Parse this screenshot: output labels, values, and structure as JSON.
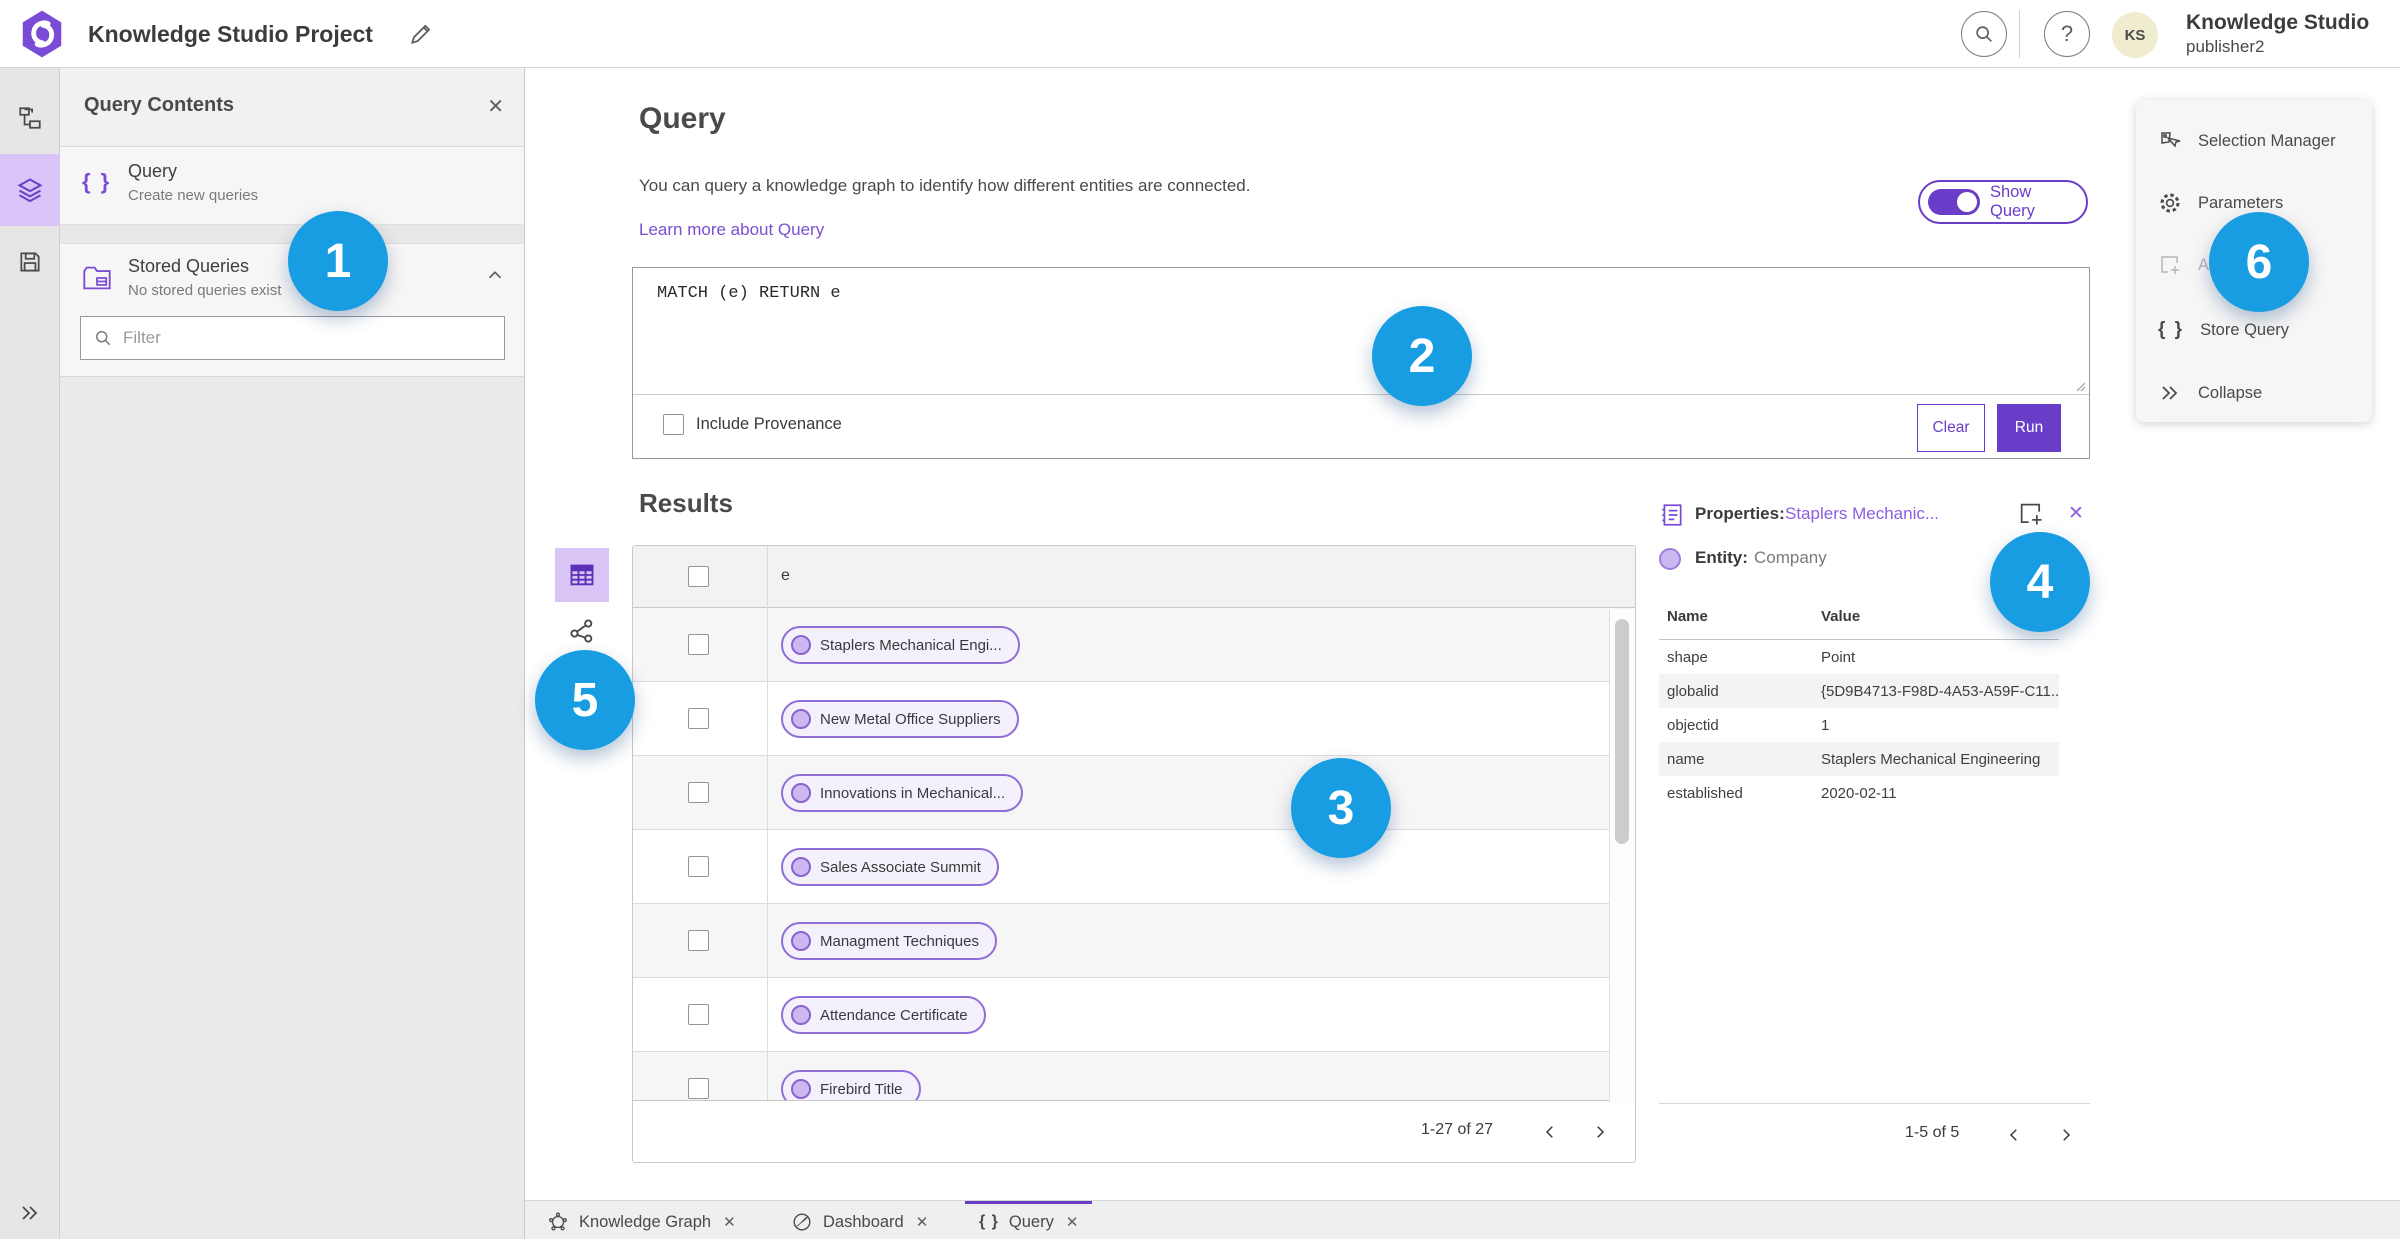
{
  "topbar": {
    "title": "Knowledge Studio Project",
    "user": {
      "initials": "KS",
      "org": "Knowledge Studio",
      "username": "publisher2"
    }
  },
  "sidebar": {
    "title": "Query Contents",
    "items": [
      {
        "label": "Query",
        "description": "Create new queries"
      },
      {
        "label": "Stored Queries",
        "description": "No stored queries exist"
      }
    ],
    "filter_placeholder": "Filter"
  },
  "query": {
    "heading": "Query",
    "description": "You can query a knowledge graph to identify how different entities are connected.",
    "learn_more": "Learn more about Query",
    "show_query_label": "Show Query",
    "code": "MATCH (e) RETURN e",
    "include_provenance_label": "Include Provenance",
    "clear_label": "Clear",
    "run_label": "Run"
  },
  "results": {
    "heading": "Results",
    "column": "e",
    "rows": [
      "Staplers Mechanical Engi...",
      "New Metal Office Suppliers",
      "Innovations in Mechanical...",
      "Sales Associate Summit",
      "Managment Techniques",
      "Attendance Certificate",
      "Firebird Title"
    ],
    "pagination": "1-27 of 27"
  },
  "properties": {
    "heading": "Properties:",
    "entity_link": "Staplers Mechanic...",
    "entity_label": "Entity:",
    "entity_type": "Company",
    "columns": [
      "Name",
      "Value"
    ],
    "rows": [
      {
        "name": "shape",
        "value": "Point"
      },
      {
        "name": "globalid",
        "value": "{5D9B4713-F98D-4A53-A59F-C11..."
      },
      {
        "name": "objectid",
        "value": "1"
      },
      {
        "name": "name",
        "value": "Staplers Mechanical Engineering"
      },
      {
        "name": "established",
        "value": "2020-02-11"
      }
    ],
    "pagination": "1-5 of 5"
  },
  "action_menu": {
    "items": [
      {
        "label": "Selection Manager"
      },
      {
        "label": "Parameters"
      },
      {
        "label": "Add To Map"
      },
      {
        "label": "Store Query"
      },
      {
        "label": "Collapse"
      }
    ]
  },
  "tabs": [
    {
      "label": "Knowledge Graph"
    },
    {
      "label": "Dashboard"
    },
    {
      "label": "Query"
    }
  ],
  "annotations": [
    "1",
    "2",
    "3",
    "4",
    "5",
    "6"
  ],
  "colors": {
    "accent": "#6a3dc8",
    "accent_light": "#8a5fe0",
    "annotation_blue": "#189de3",
    "chip_fill": "#f4f0fc",
    "chip_dot": "#ccb8f0"
  }
}
